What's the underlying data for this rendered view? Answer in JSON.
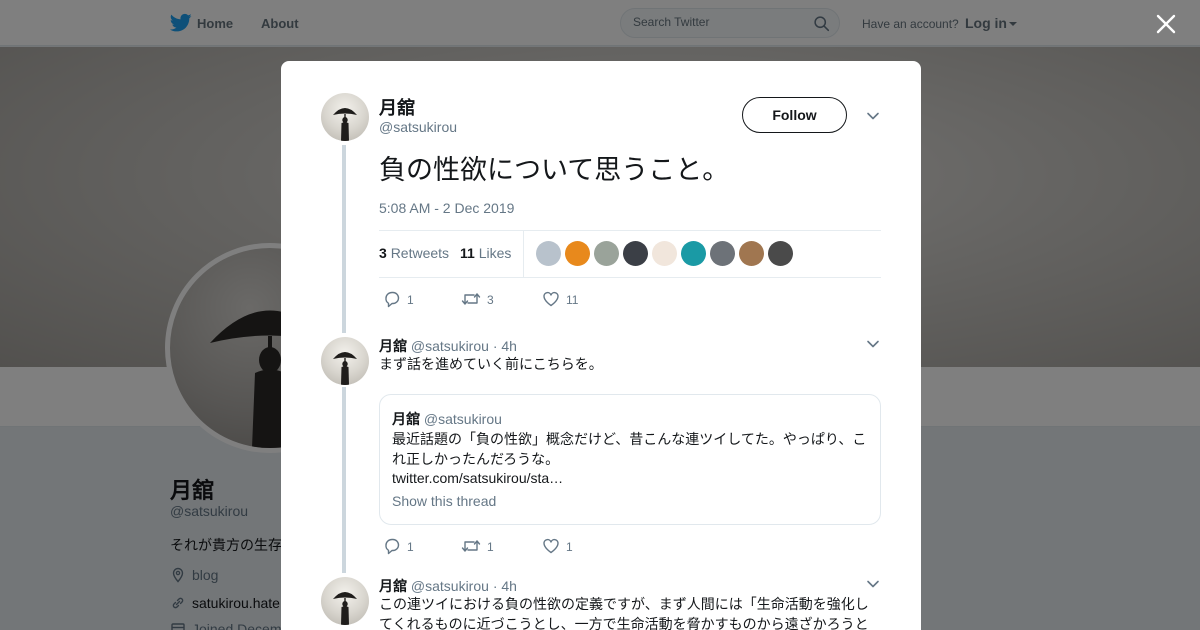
{
  "nav": {
    "home_label": "Home",
    "about_label": "About",
    "search_placeholder": "Search Twitter",
    "account_question": "Have an account?",
    "login_label": "Log in"
  },
  "profile": {
    "name": "月舘",
    "handle": "@satsukirou",
    "bio": "それが貴方の生存",
    "blog_label": "blog",
    "url": "satukirou.hate",
    "joined": "Joined Decem"
  },
  "tweet": {
    "author_name": "月舘",
    "author_handle": "@satsukirou",
    "follow_label": "Follow",
    "text": "負の性欲について思うこと。",
    "timestamp": "5:08 AM - 2 Dec 2019",
    "retweets_count": "3",
    "retweets_label": "Retweets",
    "likes_count": "11",
    "likes_label": "Likes",
    "likers_colors": [
      "#b8c2cc",
      "#e8891c",
      "#9aa39a",
      "#3b3f46",
      "#f1e6dc",
      "#1a9aa5",
      "#6d7278",
      "#a07650",
      "#4a4a4a"
    ],
    "replies": "1",
    "retweets": "3",
    "likes": "11"
  },
  "replies": [
    {
      "name": "月舘",
      "handle": "@satsukirou",
      "time": "· 4h",
      "text": "まず話を進めていく前にこちらを。",
      "quote": {
        "name": "月舘",
        "handle": "@satsukirou",
        "text": "最近話題の「負の性欲」概念だけど、昔こんな連ツイしてた。やっぱり、これ正しかったんだろうな。",
        "link": "twitter.com/satsukirou/sta…",
        "show_thread": "Show this thread"
      },
      "replies": "1",
      "retweets": "1",
      "likes": "1"
    },
    {
      "name": "月舘",
      "handle": "@satsukirou",
      "time": "· 4h",
      "text": "この連ツイにおける負の性欲の定義ですが、まず人間には「生命活動を強化してくれるものに近づこうとし、一方で生命活動を脅かすものから遠ざかろうと"
    }
  ]
}
